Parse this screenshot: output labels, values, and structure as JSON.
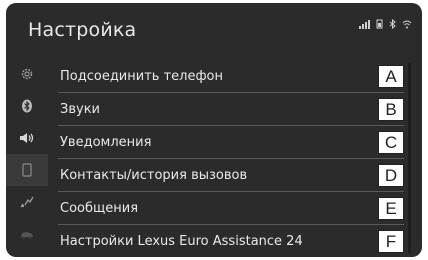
{
  "header": {
    "title": "Настройка"
  },
  "status_icons": [
    "signal-icon",
    "battery-icon",
    "bluetooth-icon",
    "wifi-icon"
  ],
  "sidebar": {
    "items": [
      {
        "icon": "gear-icon"
      },
      {
        "icon": "bluetooth-icon"
      },
      {
        "icon": "speaker-icon"
      },
      {
        "icon": "phone-icon",
        "active": true
      },
      {
        "icon": "message-icon"
      },
      {
        "icon": "car-icon"
      }
    ]
  },
  "menu": {
    "items": [
      {
        "label": "Подсоединить телефон",
        "callout": "A"
      },
      {
        "label": "Звуки",
        "callout": "B"
      },
      {
        "label": "Уведомления",
        "callout": "C"
      },
      {
        "label": "Контакты/история вызовов",
        "callout": "D"
      },
      {
        "label": "Сообщения",
        "callout": "E"
      },
      {
        "label": "Настройки Lexus Euro Assistance 24",
        "callout": "F"
      }
    ]
  },
  "colors": {
    "screen_bg": "#2b2b2b",
    "text": "#e9e9e9",
    "divider": "#5a5a5a"
  }
}
